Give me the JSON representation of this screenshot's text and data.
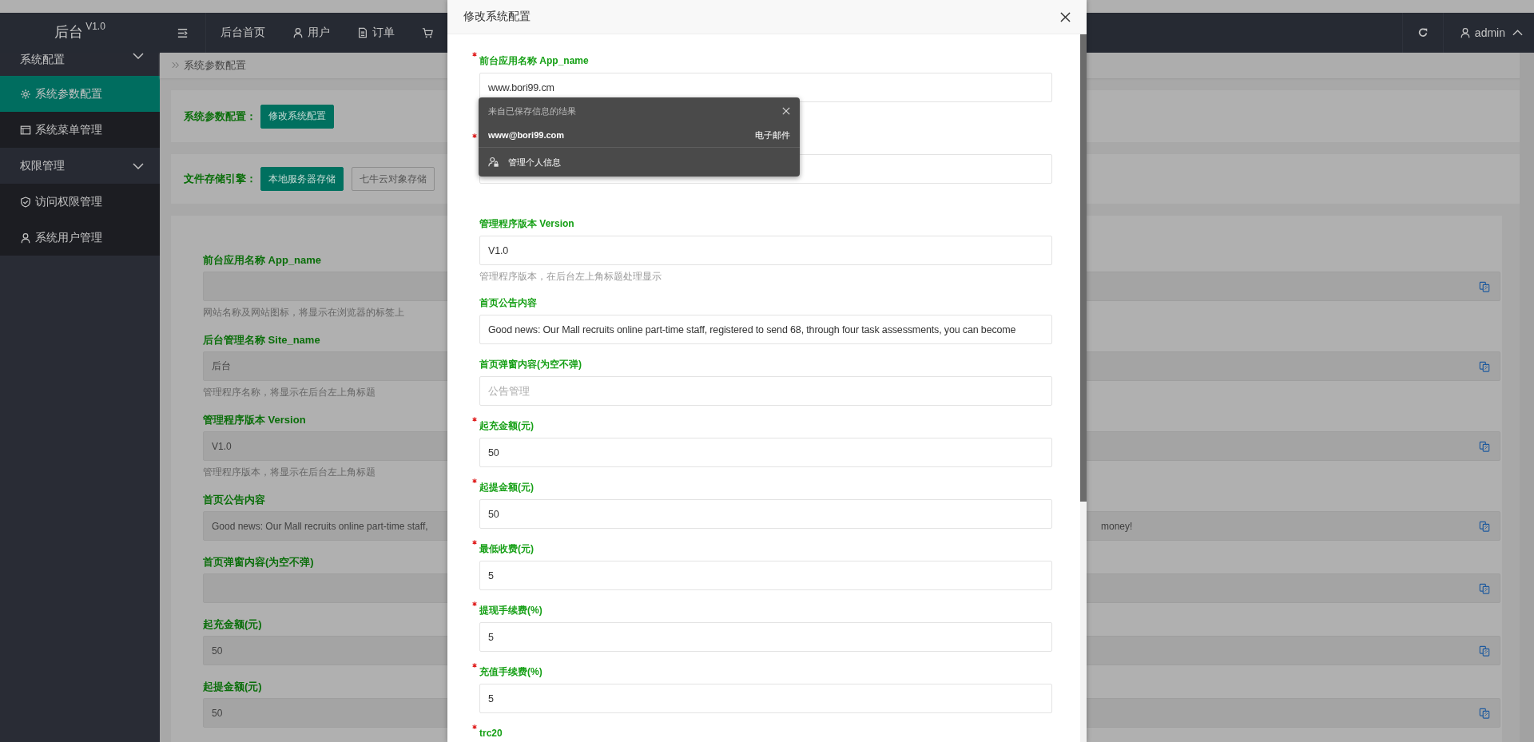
{
  "header": {
    "logo": "后台",
    "version": "V1.0",
    "nav": [
      {
        "label": "后台首页",
        "kind": "plain"
      },
      {
        "label": "用户",
        "kind": "user"
      },
      {
        "label": "订单",
        "kind": "doc"
      },
      {
        "kind": "cart"
      }
    ],
    "user": "admin"
  },
  "sidebar": {
    "groups": [
      {
        "label": "系统配置",
        "expanded": true,
        "children": [
          {
            "label": "系统参数配置",
            "kind": "gear",
            "selected": true
          },
          {
            "label": "系统菜单管理",
            "kind": "window",
            "selected": false
          }
        ]
      },
      {
        "label": "权限管理",
        "expanded": true,
        "children": [
          {
            "label": "访问权限管理",
            "kind": "shield",
            "selected": false
          },
          {
            "label": "系统用户管理",
            "kind": "user",
            "selected": false
          }
        ]
      }
    ]
  },
  "breadcrumb": "系统参数配置",
  "config_card": {
    "label": "系统参数配置：",
    "button": "修改系统配置"
  },
  "storage_card": {
    "label": "文件存储引擎：",
    "options": [
      {
        "label": "本地服务器存储",
        "selected": true
      },
      {
        "label": "七牛云对象存储",
        "selected": false
      }
    ]
  },
  "settings_form": {
    "fields": [
      {
        "label": "前台应用名称 App_name",
        "help": "网站名称及网站图标，将显示在浏览器的标签上"
      },
      {
        "label": "后台管理名称 Site_name",
        "value": "后台",
        "help": "管理程序名称，将显示在后台左上角标题"
      },
      {
        "label": "管理程序版本 Version",
        "value": "V1.0",
        "help": "管理程序版本，将显示在后台左上角标题"
      },
      {
        "label": "首页公告内容",
        "value": "Good news: Our Mall recruits online part-time staff,",
        "value_end": "money!"
      },
      {
        "label": "首页弹窗内容(为空不弹)"
      },
      {
        "label": "起充金额(元)",
        "value": "50"
      },
      {
        "label": "起提金额(元)",
        "value": "50"
      }
    ]
  },
  "modal": {
    "title": "修改系统配置",
    "fields": [
      {
        "required": true,
        "label": "前台应用名称 App_name",
        "value": "www.bori99.cm"
      },
      {
        "required": true
      },
      {
        "required": false,
        "label": "管理程序版本 Version",
        "value": "V1.0",
        "help": "管理程序版本，在后台左上角标题处理显示"
      },
      {
        "required": false,
        "label": "首页公告内容",
        "value": "Good news: Our Mall recruits online part-time staff, registered to send 68, through four task assessments, you can become"
      },
      {
        "required": false,
        "label": "首页弹窗内容(为空不弹)",
        "placeholder": "公告管理"
      },
      {
        "required": true,
        "label": "起充金额(元)",
        "value": "50"
      },
      {
        "required": true,
        "label": "起提金额(元)",
        "value": "50"
      },
      {
        "required": true,
        "label": "最低收费(元)",
        "value": "5"
      },
      {
        "required": true,
        "label": "提现手续费(%)",
        "value": "5"
      },
      {
        "required": true,
        "label": "充值手续费(%)",
        "value": "5"
      },
      {
        "required": true,
        "label": "trc20"
      }
    ],
    "autofill": {
      "heading": "来自已保存信息的结果",
      "suggestion": "www@bori99.com",
      "suggestion_type": "电子邮件",
      "manage": "管理个人信息"
    }
  }
}
